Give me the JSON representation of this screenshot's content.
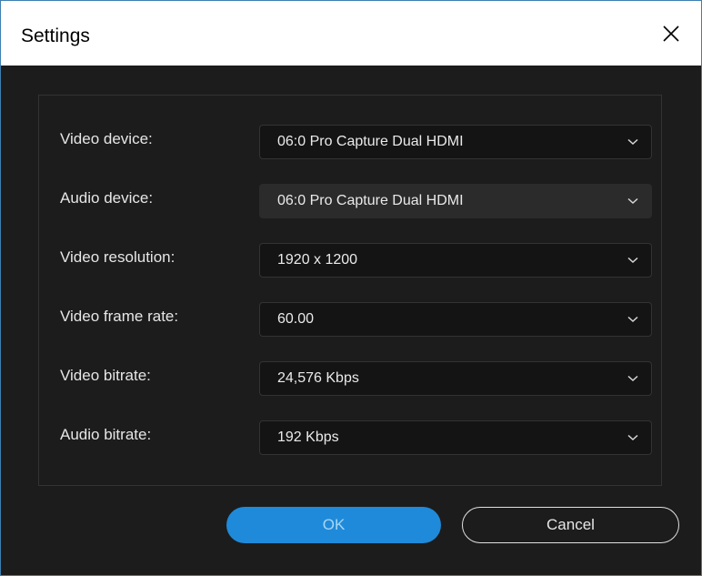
{
  "window": {
    "title": "Settings"
  },
  "settings": {
    "rows": [
      {
        "label": "Video device:",
        "value": "06:0 Pro Capture Dual HDMI",
        "enabled": true
      },
      {
        "label": "Audio device:",
        "value": "06:0 Pro Capture Dual HDMI",
        "enabled": false
      },
      {
        "label": "Video resolution:",
        "value": "1920 x 1200",
        "enabled": true
      },
      {
        "label": "Video frame rate:",
        "value": "60.00",
        "enabled": true
      },
      {
        "label": "Video bitrate:",
        "value": "24,576 Kbps",
        "enabled": true
      },
      {
        "label": "Audio bitrate:",
        "value": "192 Kbps",
        "enabled": true
      }
    ]
  },
  "buttons": {
    "ok_label": "OK",
    "cancel_label": "Cancel"
  },
  "icons": {
    "close": "close-icon",
    "dropdown": "chevron-down-icon"
  },
  "colors": {
    "accent": "#1f8ad9",
    "background": "#1c1c1c",
    "text": "#e6e6e6"
  }
}
